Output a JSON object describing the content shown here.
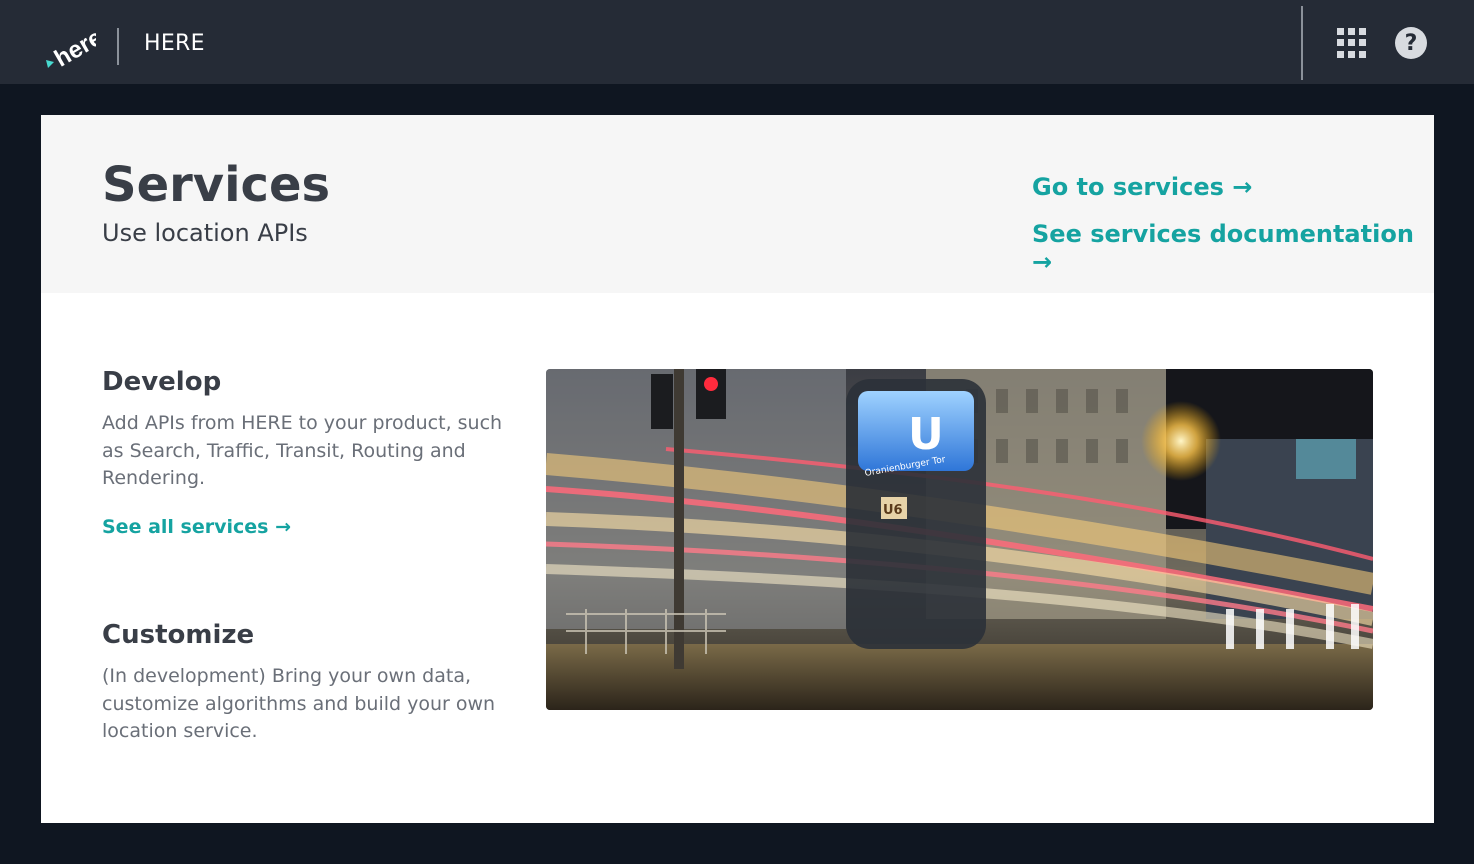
{
  "topbar": {
    "logo_text": "here",
    "brand": "HERE",
    "apps_icon": "apps-grid-icon",
    "help_icon": "help-icon",
    "help_glyph": "?"
  },
  "header": {
    "title": "Services",
    "subtitle": "Use location APIs",
    "links": [
      {
        "label": "Go to services →"
      },
      {
        "label": "See services documentation →"
      }
    ]
  },
  "sections": [
    {
      "title": "Develop",
      "body": "Add APIs from HERE to your product, such as Search, Traffic, Transit, Routing and Rendering.",
      "link": "See all services →"
    },
    {
      "title": "Customize",
      "body": "(In development) Bring your own data, customize algorithms and build your own location service."
    }
  ],
  "photo": {
    "sign_letter": "U",
    "sign_station": "Oranienburger Tor",
    "line_label": "U6"
  },
  "colors": {
    "topbar": "#252b36",
    "background": "#0f1621",
    "accent": "#15a3a1",
    "heading": "#393e47",
    "body_text": "#6a6f78"
  }
}
